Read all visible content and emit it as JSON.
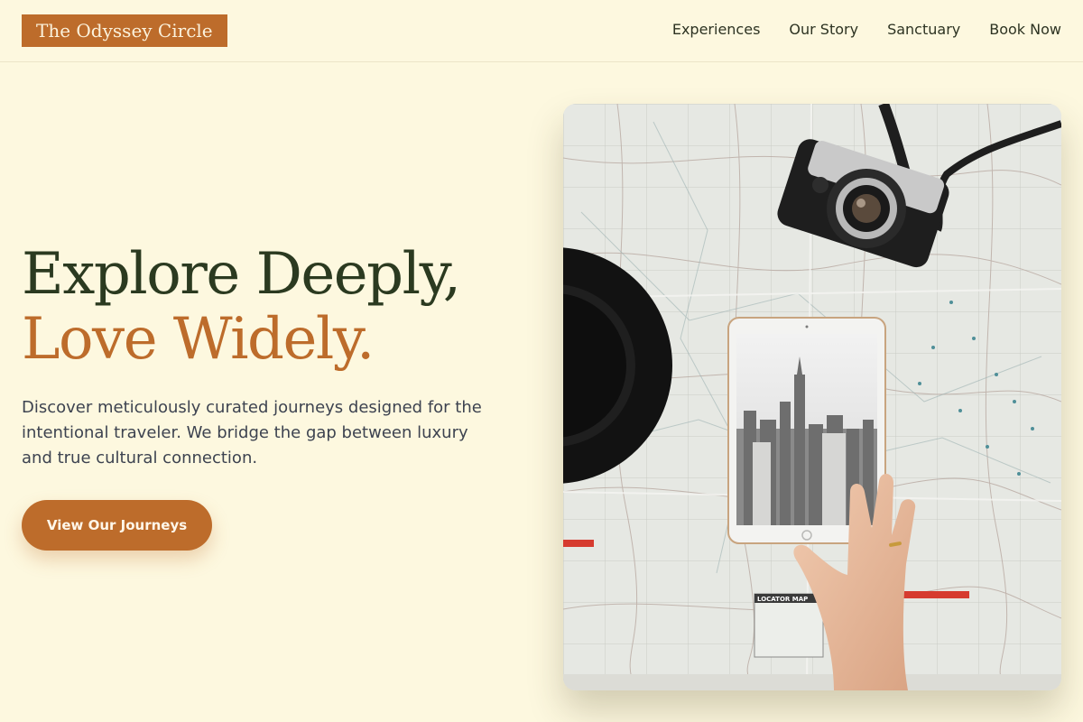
{
  "brand": {
    "name": "The Odyssey Circle"
  },
  "nav": {
    "items": [
      {
        "label": "Experiences"
      },
      {
        "label": "Our Story"
      },
      {
        "label": "Sanctuary"
      },
      {
        "label": "Book Now"
      }
    ]
  },
  "hero": {
    "headline_line1": "Explore Deeply,",
    "headline_line2": "Love Widely.",
    "description": "Discover meticulously curated journeys designed for the intentional traveler. We bridge the gap between luxury and true cultural connection.",
    "cta_label": "View Our Journeys",
    "image": {
      "subject": "map-with-camera-tablet-hat",
      "map_label": "LOCATOR MAP"
    }
  },
  "colors": {
    "background": "#fdf8df",
    "accent": "#bd6c2b",
    "heading_dark": "#2b3a20",
    "body_text": "#3d4350"
  }
}
